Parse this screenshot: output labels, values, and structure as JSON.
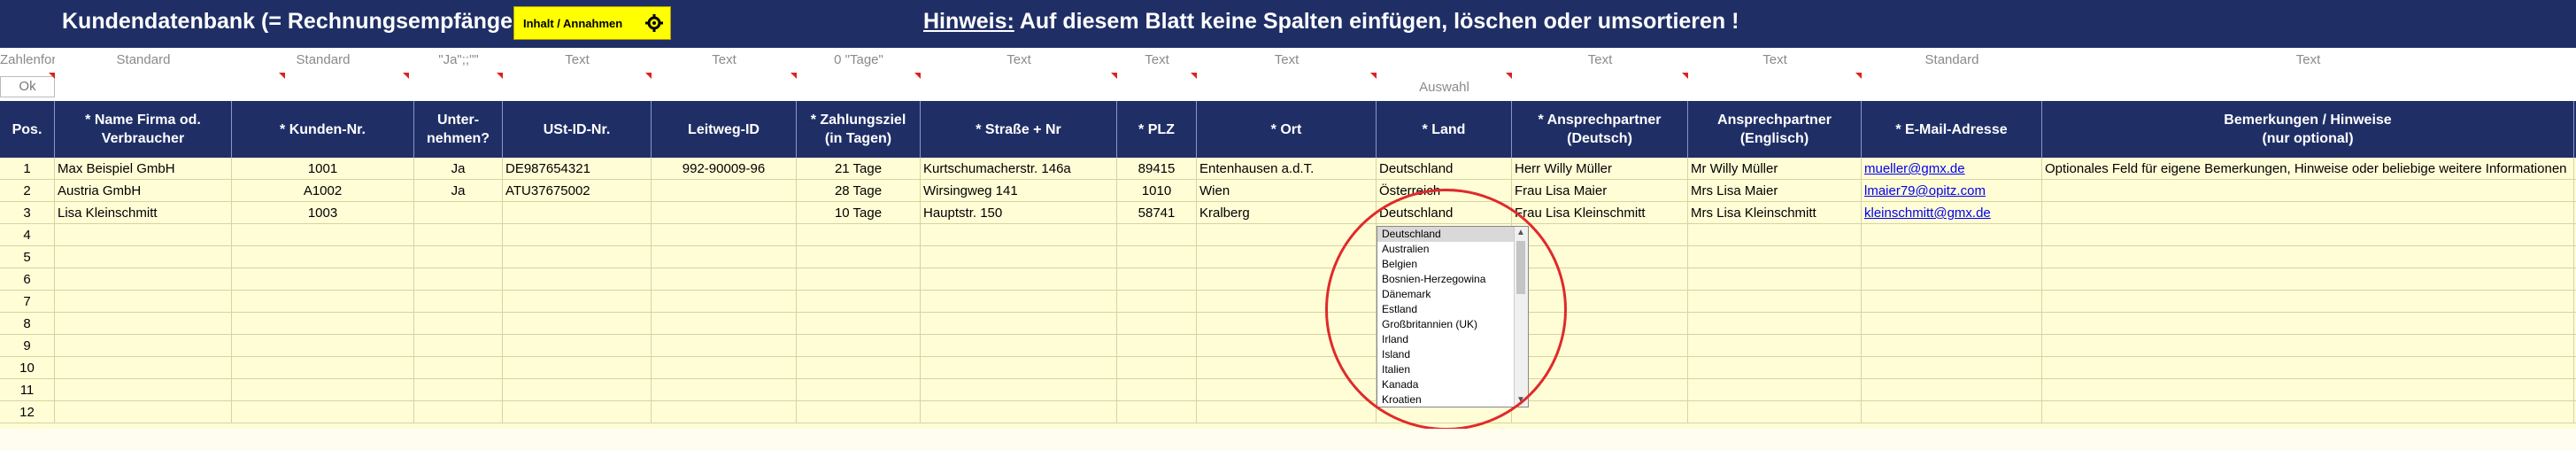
{
  "title": "Kundendatenbank (= Rechnungsempfänge",
  "button_label": "Inhalt / Annahmen",
  "hint_label": "Hinweis:",
  "hint_text": " Auf diesem Blatt keine Spalten einfügen, löschen oder umsortieren !",
  "ok_label": "Ok",
  "auswahl_label": "Auswahl",
  "formats": [
    "Zahlenform",
    "Standard",
    "Standard",
    "\"Ja\";;\"\"",
    "Text",
    "Text",
    "0 \"Tage\"",
    "Text",
    "Text",
    "Text",
    "",
    "Text",
    "Text",
    "Standard",
    "Text"
  ],
  "headers": [
    {
      "l1": "Pos.",
      "l2": ""
    },
    {
      "l1": "* Name Firma od. Verbraucher",
      "l2": ""
    },
    {
      "l1": "* Kunden-Nr.",
      "l2": ""
    },
    {
      "l1": "Unter-",
      "l2": "nehmen?"
    },
    {
      "l1": "USt-ID-Nr.",
      "l2": ""
    },
    {
      "l1": "Leitweg-ID",
      "l2": ""
    },
    {
      "l1": "* Zahlungsziel",
      "l2": "(in Tagen)"
    },
    {
      "l1": "* Straße + Nr",
      "l2": ""
    },
    {
      "l1": "* PLZ",
      "l2": ""
    },
    {
      "l1": "* Ort",
      "l2": ""
    },
    {
      "l1": "* Land",
      "l2": ""
    },
    {
      "l1": "* Ansprechpartner",
      "l2": "(Deutsch)"
    },
    {
      "l1": "Ansprechpartner",
      "l2": "(Englisch)"
    },
    {
      "l1": "* E-Mail-Adresse",
      "l2": ""
    },
    {
      "l1": "Bemerkungen / Hinweise",
      "l2": "(nur optional)"
    }
  ],
  "rows": [
    [
      "1",
      "Max Beispiel GmbH",
      "1001",
      "Ja",
      "DE987654321",
      "992-90009-96",
      "21 Tage",
      "Kurtschumacherstr. 146a",
      "89415",
      "Entenhausen a.d.T.",
      "Deutschland",
      "Herr Willy Müller",
      "Mr Willy Müller",
      "mueller@gmx.de",
      "Optionales Feld für eigene Bemerkungen, Hinweise oder beliebige weitere Informationen"
    ],
    [
      "2",
      "Austria GmbH",
      "A1002",
      "Ja",
      "ATU37675002",
      "",
      "28 Tage",
      "Wirsingweg 141",
      "1010",
      "Wien",
      "Österreich",
      "Frau Lisa Maier",
      "Mrs Lisa Maier",
      "lmaier79@opitz.com",
      ""
    ],
    [
      "3",
      "Lisa Kleinschmitt",
      "1003",
      "",
      "",
      "",
      "10 Tage",
      "Hauptstr. 150",
      "58741",
      "Kralberg",
      "Deutschland",
      "Frau Lisa Kleinschmitt",
      "Mrs Lisa Kleinschmitt",
      "kleinschmitt@gmx.de",
      ""
    ],
    [
      "4",
      "",
      "",
      "",
      "",
      "",
      "",
      "",
      "",
      "",
      "",
      "",
      "",
      "",
      ""
    ],
    [
      "5",
      "",
      "",
      "",
      "",
      "",
      "",
      "",
      "",
      "",
      "",
      "",
      "",
      "",
      ""
    ],
    [
      "6",
      "",
      "",
      "",
      "",
      "",
      "",
      "",
      "",
      "",
      "",
      "",
      "",
      "",
      ""
    ],
    [
      "7",
      "",
      "",
      "",
      "",
      "",
      "",
      "",
      "",
      "",
      "",
      "",
      "",
      "",
      ""
    ],
    [
      "8",
      "",
      "",
      "",
      "",
      "",
      "",
      "",
      "",
      "",
      "",
      "",
      "",
      "",
      ""
    ],
    [
      "9",
      "",
      "",
      "",
      "",
      "",
      "",
      "",
      "",
      "",
      "",
      "",
      "",
      "",
      ""
    ],
    [
      "10",
      "",
      "",
      "",
      "",
      "",
      "",
      "",
      "",
      "",
      "",
      "",
      "",
      "",
      ""
    ],
    [
      "11",
      "",
      "",
      "",
      "",
      "",
      "",
      "",
      "",
      "",
      "",
      "",
      "",
      "",
      ""
    ],
    [
      "12",
      "",
      "",
      "",
      "",
      "",
      "",
      "",
      "",
      "",
      "",
      "",
      "",
      "",
      ""
    ]
  ],
  "dropdown": [
    "Deutschland",
    "Australien",
    "Belgien",
    "Bosnien-Herzegowina",
    "Dänemark",
    "Estland",
    "Großbritannien (UK)",
    "Irland",
    "Island",
    "Italien",
    "Kanada",
    "Kroatien"
  ],
  "dropdown_selected": "Deutschland",
  "colors": {
    "header_bg": "#1f2f66",
    "grid_bg": "#fffdd6",
    "button_bg": "#ffff00",
    "highlight_circle": "#e02a2a",
    "link": "#0000ee"
  }
}
